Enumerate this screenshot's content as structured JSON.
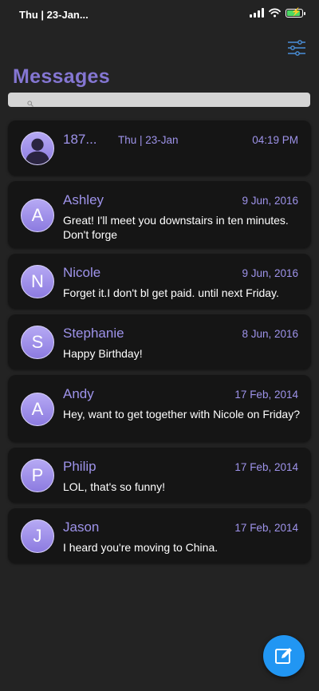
{
  "status_bar": {
    "time": "Thu | 23-Jan..."
  },
  "header": {
    "title": "Messages"
  },
  "search": {
    "placeholder": ""
  },
  "conversations": [
    {
      "sender": "187...",
      "center_date": "Thu | 23-Jan",
      "date": "04:19 PM",
      "text": "",
      "avatar": "person-silhouette"
    },
    {
      "sender": "Ashley",
      "initial": "A",
      "date": "9 Jun, 2016",
      "text": "Great! I'll meet you downstairs in ten minutes. Don't forge"
    },
    {
      "sender": "Nicole",
      "initial": "N",
      "date": "9 Jun, 2016",
      "text": "Forget it.I don't bl get paid. until next Friday."
    },
    {
      "sender": "Stephanie",
      "initial": "S",
      "date": "8 Jun, 2016",
      "text": "Happy Birthday!"
    },
    {
      "sender": "Andy",
      "initial": "A",
      "date": "17 Feb, 2014",
      "text": "Hey, want to get together with Nicole on Friday?"
    },
    {
      "sender": "Philip",
      "initial": "P",
      "date": "17 Feb, 2014",
      "text": "LOL, that's so funny!"
    },
    {
      "sender": "Jason",
      "initial": "J",
      "date": "17 Feb, 2014",
      "text": "I heard you're moving to China."
    }
  ],
  "icons": {
    "filter": "sliders-icon",
    "compose": "compose-icon",
    "search": "search-icon"
  },
  "colors": {
    "background": "#232323",
    "card": "#151515",
    "accent": "#8476d2",
    "fab": "#2196f3"
  }
}
